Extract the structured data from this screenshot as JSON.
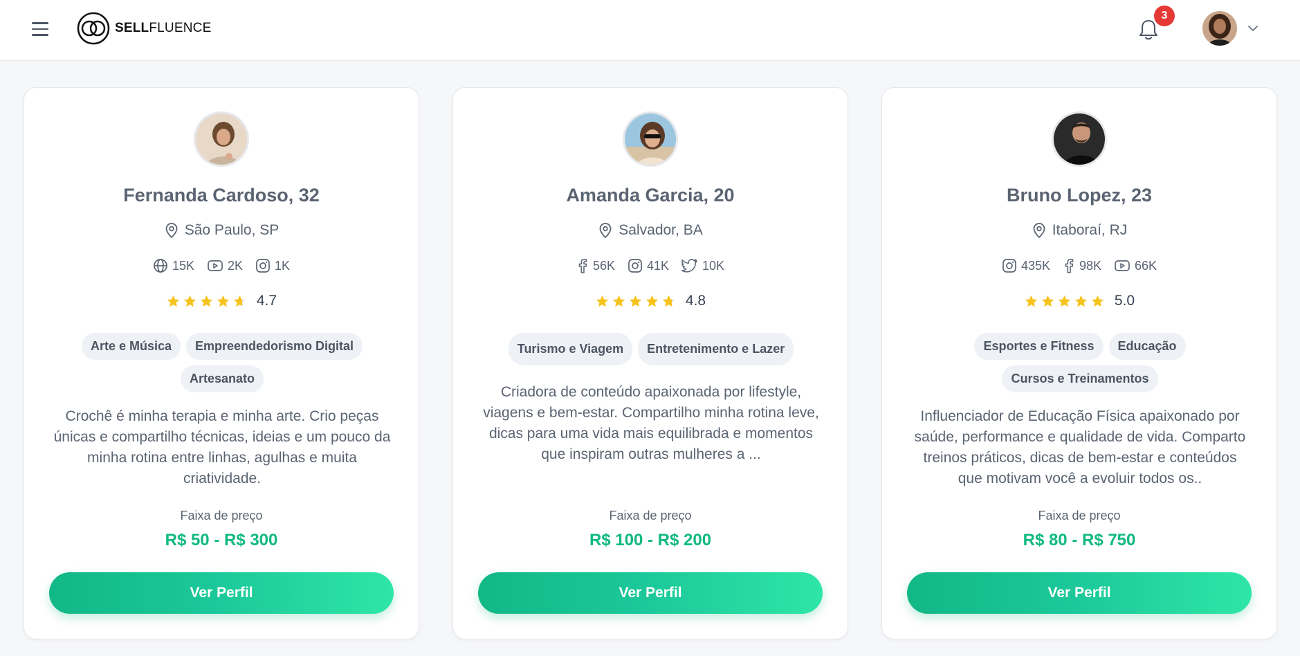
{
  "header": {
    "logo_bold": "SELL",
    "logo_light": "FLUENCE",
    "notification_count": "3"
  },
  "colors": {
    "accent": "#10b981",
    "badge": "#e53935",
    "star": "#f6c31c"
  },
  "cards": [
    {
      "name": "Fernanda Cardoso, 32",
      "location": "São Paulo, SP",
      "socials": [
        {
          "icon": "globe-icon",
          "value": "15K"
        },
        {
          "icon": "youtube-icon",
          "value": "2K"
        },
        {
          "icon": "instagram-icon",
          "value": "1K"
        }
      ],
      "rating": "4.7",
      "tags": [
        "Arte e Música",
        "Empreendedorismo Digital",
        "Artesanato"
      ],
      "description": "Crochê é minha terapia e minha arte. Crio peças únicas e compartilho técnicas, ideias e um pouco da minha rotina entre linhas, agulhas e muita criatividade.",
      "price_label": "Faixa de preço",
      "price": "R$ 50 - R$ 300",
      "button": "Ver Perfil"
    },
    {
      "name": "Amanda Garcia, 20",
      "location": "Salvador, BA",
      "socials": [
        {
          "icon": "facebook-icon",
          "value": "56K"
        },
        {
          "icon": "instagram-icon",
          "value": "41K"
        },
        {
          "icon": "twitter-icon",
          "value": "10K"
        }
      ],
      "rating": "4.8",
      "tags": [
        "Turismo e Viagem",
        "Entretenimento e Lazer"
      ],
      "description": "Criadora de conteúdo apaixonada por lifestyle, viagens e bem-estar. Compartilho minha rotina leve, dicas para uma vida mais equilibrada e momentos que inspiram outras mulheres a ...",
      "price_label": "Faixa de preço",
      "price": "R$ 100 - R$ 200",
      "button": "Ver Perfil"
    },
    {
      "name": "Bruno Lopez, 23",
      "location": "Itaboraí, RJ",
      "socials": [
        {
          "icon": "instagram-icon",
          "value": "435K"
        },
        {
          "icon": "facebook-icon",
          "value": "98K"
        },
        {
          "icon": "youtube-icon",
          "value": "66K"
        }
      ],
      "rating": "5.0",
      "tags": [
        "Esportes e Fitness",
        "Educação",
        "Cursos e Treinamentos"
      ],
      "description": "Influenciador de Educação Física apaixonado por saúde, performance e qualidade de vida. Comparto treinos práticos, dicas de bem-estar e conteúdos que motivam você a evoluir todos os..",
      "price_label": "Faixa de preço",
      "price": "R$ 80 - R$ 750",
      "button": "Ver Perfil"
    }
  ]
}
